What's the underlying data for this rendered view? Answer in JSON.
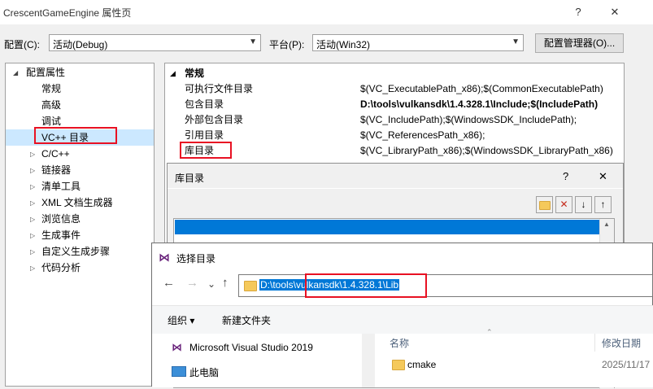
{
  "window": {
    "title": "CrescentGameEngine 属性页",
    "help_glyph": "?",
    "close_glyph": "✕"
  },
  "config_bar": {
    "config_label": "配置(C):",
    "config_value": "活动(Debug)",
    "platform_label": "平台(P):",
    "platform_value": "活动(Win32)",
    "manager_button": "配置管理器(O)..."
  },
  "tree": {
    "root": "配置属性",
    "items": [
      "常规",
      "高级",
      "调试",
      "VC++ 目录",
      "C/C++",
      "链接器",
      "清单工具",
      "XML 文档生成器",
      "浏览信息",
      "生成事件",
      "自定义生成步骤",
      "代码分析"
    ],
    "selected": "VC++ 目录"
  },
  "grid": {
    "section": "常规",
    "rows": [
      {
        "name": "可执行文件目录",
        "value": "$(VC_ExecutablePath_x86);$(CommonExecutablePath)"
      },
      {
        "name": "包含目录",
        "value": "D:\\tools\\vulkansdk\\1.4.328.1\\Include;$(IncludePath)"
      },
      {
        "name": "外部包含目录",
        "value": "$(VC_IncludePath);$(WindowsSDK_IncludePath);"
      },
      {
        "name": "引用目录",
        "value": "$(VC_ReferencesPath_x86);"
      },
      {
        "name": "库目录",
        "value": "$(VC_LibraryPath_x86);$(WindowsSDK_LibraryPath_x86)"
      }
    ]
  },
  "lib_dialog": {
    "title": "库目录",
    "help_glyph": "?",
    "close_glyph": "✕",
    "toolbar": {
      "new_line": "new-line",
      "delete": "✕",
      "down": "↓",
      "up": "↑"
    }
  },
  "folder_dialog": {
    "title": "选择目录",
    "address": "D:\\tools\\vulkansdk\\1.4.328.1\\Lib",
    "organize": "组织 ▾",
    "new_folder": "新建文件夹",
    "nav": {
      "back": "←",
      "forward": "→",
      "recent": "⌄",
      "up": "↑"
    },
    "sidebar": [
      {
        "label": "Microsoft Visual Studio 2019",
        "icon": "visual-studio-icon"
      },
      {
        "label": "此电脑",
        "icon": "computer-icon"
      }
    ],
    "columns": {
      "name": "名称",
      "modified": "修改日期"
    },
    "files": [
      {
        "name": "cmake",
        "modified": "2025/11/17"
      }
    ]
  }
}
